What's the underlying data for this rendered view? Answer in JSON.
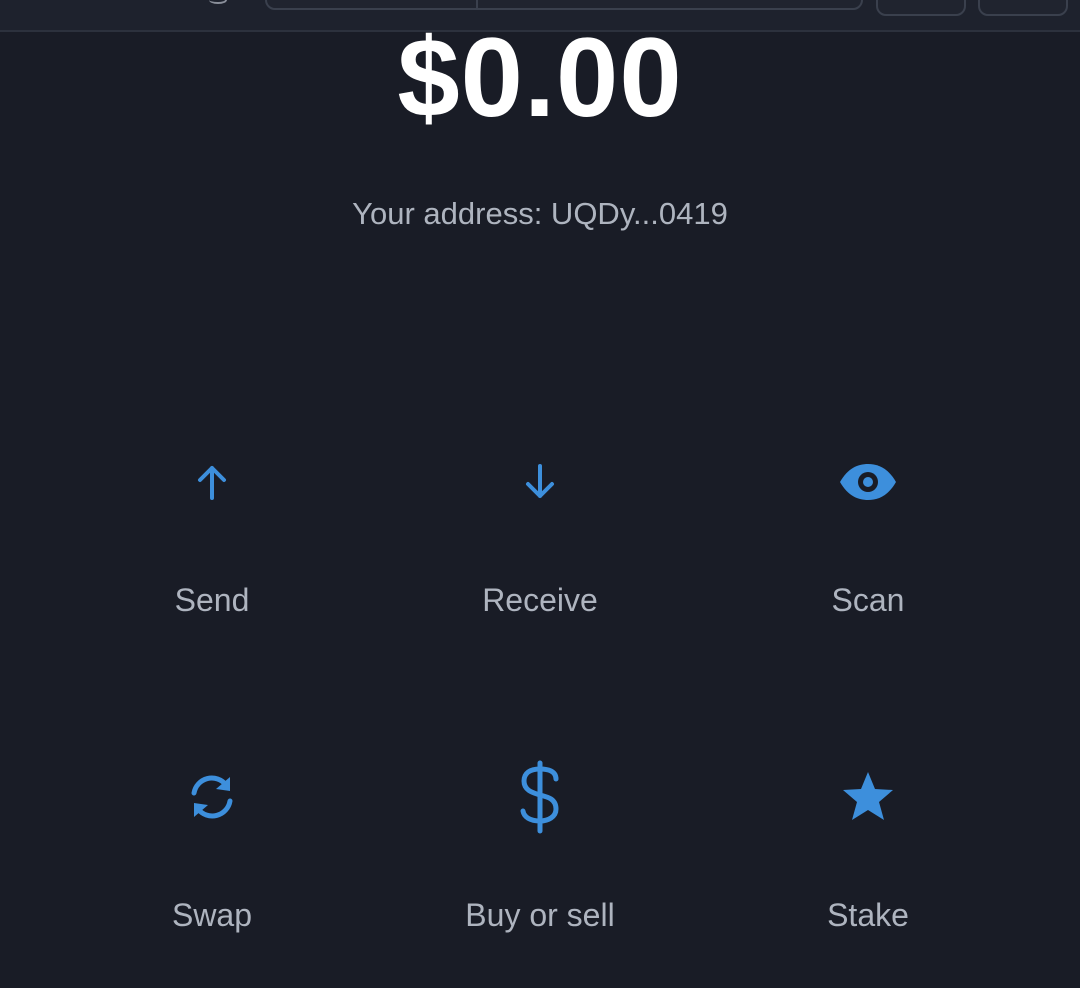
{
  "balance": {
    "amount": "$0.00"
  },
  "address": {
    "text": "Your address: UQDy...0419"
  },
  "actions": [
    {
      "label": "Send",
      "icon": "arrow-up-icon"
    },
    {
      "label": "Receive",
      "icon": "arrow-down-icon"
    },
    {
      "label": "Scan",
      "icon": "eye-icon"
    },
    {
      "label": "Swap",
      "icon": "swap-arrows-icon"
    },
    {
      "label": "Buy or sell",
      "icon": "dollar-icon"
    },
    {
      "label": "Stake",
      "icon": "star-icon"
    }
  ],
  "colors": {
    "background": "#191c26",
    "accent": "#3d8fdc",
    "text_primary": "#ffffff",
    "text_secondary": "#aeb4bf"
  }
}
